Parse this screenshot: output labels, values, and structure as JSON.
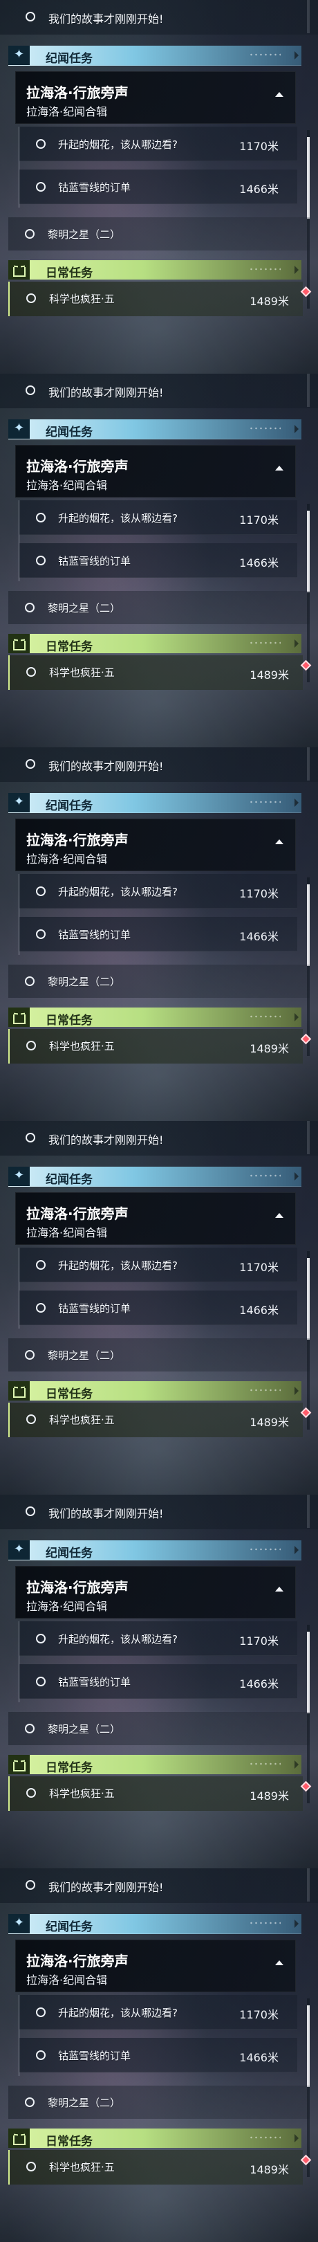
{
  "panels": [
    {
      "top_quest": "我们的故事才刚刚开始!",
      "section_header": "纪闻任务",
      "main_card": {
        "title": "拉海洛·行旅旁声",
        "subtitle": "拉海洛·纪闻合辑"
      },
      "sub_quests": [
        {
          "title": "升起的烟花，该从哪边看?",
          "distance": "1170米"
        },
        {
          "title": "钴蓝雪线的订单",
          "distance": "1466米"
        }
      ],
      "misc_quest": "黎明之星（二）",
      "daily_header": "日常任务",
      "daily_quest": {
        "title": "科学也疯狂·五",
        "distance": "1489米"
      }
    },
    {
      "top_quest": "我们的故事才刚刚开始!",
      "section_header": "纪闻任务",
      "main_card": {
        "title": "拉海洛·行旅旁声",
        "subtitle": "拉海洛·纪闻合辑"
      },
      "sub_quests": [
        {
          "title": "升起的烟花，该从哪边看?",
          "distance": "1170米"
        },
        {
          "title": "钴蓝雪线的订单",
          "distance": "1466米"
        }
      ],
      "misc_quest": "黎明之星（二）",
      "daily_header": "日常任务",
      "daily_quest": {
        "title": "科学也疯狂·五",
        "distance": "1489米"
      }
    },
    {
      "top_quest": "我们的故事才刚刚开始!",
      "section_header": "纪闻任务",
      "main_card": {
        "title": "拉海洛·行旅旁声",
        "subtitle": "拉海洛·纪闻合辑"
      },
      "sub_quests": [
        {
          "title": "升起的烟花，该从哪边看?",
          "distance": "1170米"
        },
        {
          "title": "钴蓝雪线的订单",
          "distance": "1466米"
        }
      ],
      "misc_quest": "黎明之星（二）",
      "daily_header": "日常任务",
      "daily_quest": {
        "title": "科学也疯狂·五",
        "distance": "1489米"
      }
    },
    {
      "top_quest": "我们的故事才刚刚开始!",
      "section_header": "纪闻任务",
      "main_card": {
        "title": "拉海洛·行旅旁声",
        "subtitle": "拉海洛·纪闻合辑"
      },
      "sub_quests": [
        {
          "title": "升起的烟花，该从哪边看?",
          "distance": "1170米"
        },
        {
          "title": "钴蓝雪线的订单",
          "distance": "1466米"
        }
      ],
      "misc_quest": "黎明之星（二）",
      "daily_header": "日常任务",
      "daily_quest": {
        "title": "科学也疯狂·五",
        "distance": "1489米"
      }
    },
    {
      "top_quest": "我们的故事才刚刚开始!",
      "section_header": "纪闻任务",
      "main_card": {
        "title": "拉海洛·行旅旁声",
        "subtitle": "拉海洛·纪闻合辑"
      },
      "sub_quests": [
        {
          "title": "升起的烟花，该从哪边看?",
          "distance": "1170米"
        },
        {
          "title": "钴蓝雪线的订单",
          "distance": "1466米"
        }
      ],
      "misc_quest": "黎明之星（二）",
      "daily_header": "日常任务",
      "daily_quest": {
        "title": "科学也疯狂·五",
        "distance": "1489米"
      }
    },
    {
      "top_quest": "我们的故事才刚刚开始!",
      "section_header": "纪闻任务",
      "main_card": {
        "title": "拉海洛·行旅旁声",
        "subtitle": "拉海洛·纪闻合辑"
      },
      "sub_quests": [
        {
          "title": "升起的烟花，该从哪边看?",
          "distance": "1170米"
        },
        {
          "title": "钴蓝雪线的订单",
          "distance": "1466米"
        }
      ],
      "misc_quest": "黎明之星（二）",
      "daily_header": "日常任务",
      "daily_quest": {
        "title": "科学也疯狂·五",
        "distance": "1489米"
      }
    }
  ],
  "icons": {
    "section": "star-icon",
    "daily": "book-icon",
    "collapse": "collapse-icon",
    "marker": "diamond-marker-icon"
  },
  "colors": {
    "section_accent": "#80c7e3",
    "daily_accent": "#b7df82",
    "marker": "#ff5b6a"
  }
}
